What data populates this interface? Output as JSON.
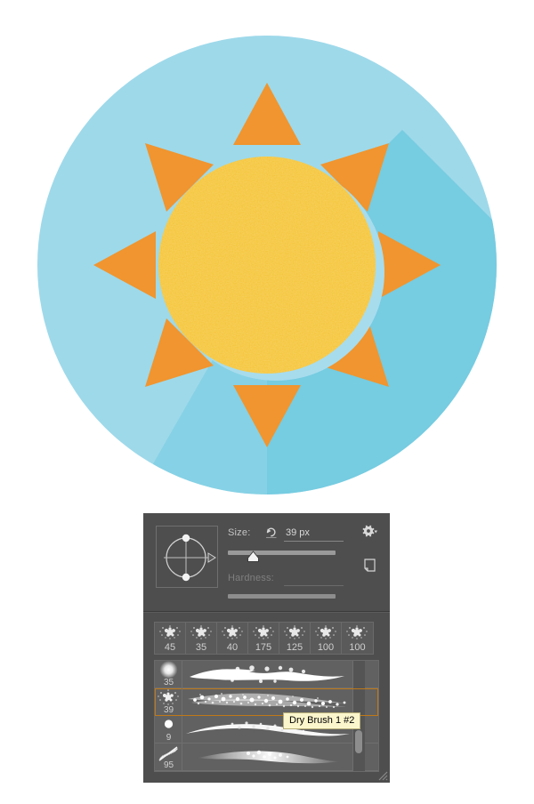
{
  "illustration": {
    "name": "flat-sun-icon",
    "background_circle_color": "#9ed9ea",
    "shadow_color": "#6ec9df",
    "ray_color": "#f0952f",
    "sun_color": "#f5c32e",
    "sun_rim_color": "#a7dced",
    "ray_count": 8,
    "canvas_background": "#ffffff"
  },
  "panel": {
    "name": "brush-preset-panel",
    "background_color": "#4e4e4e",
    "accent_selection_color": "#c07818",
    "options": {
      "size_label": "Size:",
      "size_value": "39 px",
      "size_reset_icon": "reset-arrow-icon",
      "hardness_label": "Hardness:",
      "hardness_value": "",
      "gear_icon": "gear-icon",
      "new_preset_icon": "new-preset-icon",
      "angle_widget": "brush-angle-roundness-widget"
    },
    "preset_strip": {
      "items": [
        {
          "size": "45",
          "thumb": "spatter-brush-thumb"
        },
        {
          "size": "35",
          "thumb": "spatter-brush-thumb"
        },
        {
          "size": "40",
          "thumb": "spatter-brush-thumb"
        },
        {
          "size": "175",
          "thumb": "spatter-brush-thumb"
        },
        {
          "size": "125",
          "thumb": "spatter-brush-thumb"
        },
        {
          "size": "100",
          "thumb": "spatter-brush-thumb"
        },
        {
          "size": "100",
          "thumb": "spatter-brush-thumb"
        }
      ]
    },
    "brush_list": {
      "rows": [
        {
          "size": "35",
          "tip": "soft-round-tip",
          "stroke": "rough-wide-stroke",
          "selected": false
        },
        {
          "size": "39",
          "tip": "spatter-tip",
          "stroke": "dry-brush-stroke",
          "selected": true
        },
        {
          "size": "9",
          "tip": "hard-round-tip",
          "stroke": "tapered-stroke",
          "selected": false
        },
        {
          "size": "95",
          "tip": "angled-bristle-tip",
          "stroke": "soft-blended-stroke",
          "selected": false
        }
      ]
    },
    "tooltip": {
      "text": "Dry Brush 1 #2",
      "background_color": "#fcf6cd"
    },
    "resize_grip_icon": "resize-grip-icon"
  }
}
